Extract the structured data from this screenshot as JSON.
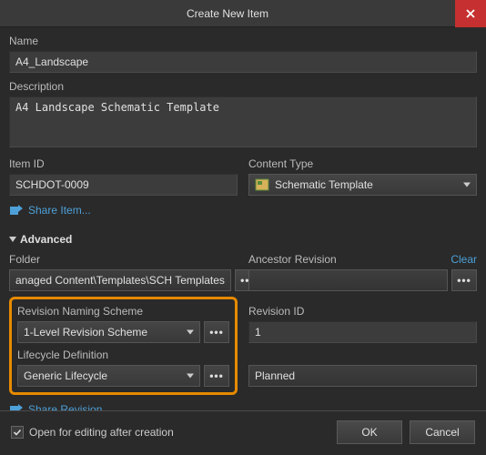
{
  "window": {
    "title": "Create New Item"
  },
  "fields": {
    "name_label": "Name",
    "name_value": "A4_Landscape",
    "description_label": "Description",
    "description_value": "A4 Landscape Schematic Template",
    "item_id_label": "Item ID",
    "item_id_value": "SCHDOT-0009",
    "content_type_label": "Content Type",
    "content_type_value": "Schematic Template"
  },
  "links": {
    "share_item": "Share Item...",
    "share_revision": "Share Revision..."
  },
  "advanced": {
    "toggle_label": "Advanced",
    "folder_label": "Folder",
    "folder_value": "anaged Content\\Templates\\SCH Templates",
    "ancestor_label": "Ancestor Revision",
    "ancestor_clear": "Clear",
    "ancestor_value": "",
    "revision_scheme_label": "Revision Naming Scheme",
    "revision_scheme_value": "1-Level Revision Scheme",
    "lifecycle_label": "Lifecycle Definition",
    "lifecycle_value": "Generic Lifecycle",
    "revision_id_label": "Revision ID",
    "revision_id_value": "1",
    "lifecycle_state_value": "Planned"
  },
  "bottom": {
    "open_after_label": "Open for editing after creation",
    "open_after_checked": true,
    "ok": "OK",
    "cancel": "Cancel"
  },
  "ellipsis": "•••"
}
